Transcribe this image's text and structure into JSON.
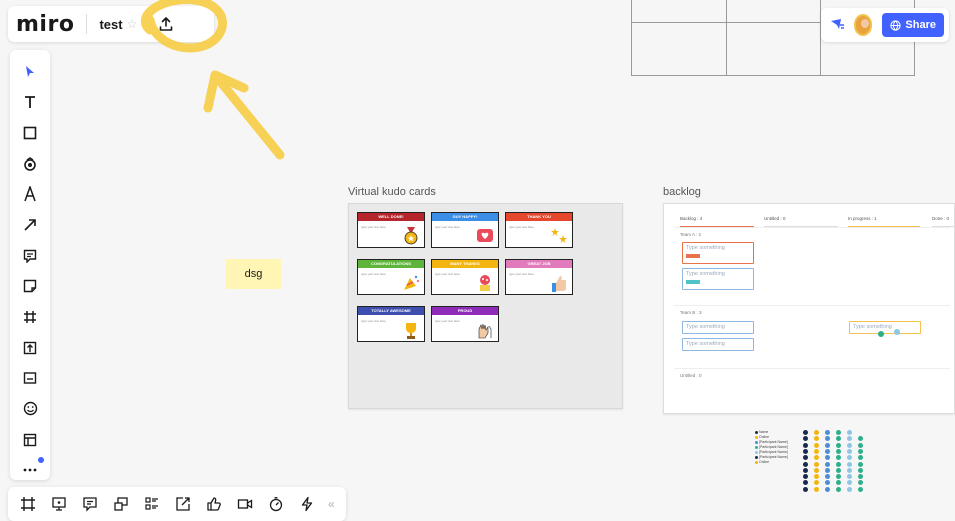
{
  "app": {
    "logo": "miro",
    "board_name": "test"
  },
  "header": {
    "share_label": "Share"
  },
  "toolbar": {
    "tools": [
      "select",
      "text",
      "shape",
      "pen",
      "line",
      "arrow",
      "comment",
      "sticky-note",
      "frame",
      "upload",
      "card",
      "emoji",
      "template",
      "more"
    ]
  },
  "bottombar": {
    "collapse_glyph": "«"
  },
  "sticky": {
    "text": "dsg"
  },
  "kudo_frame": {
    "title": "Virtual kudo cards",
    "cards": [
      {
        "heading": "WELL DONE!",
        "color": "#b5252c",
        "placeholder": "type your text here"
      },
      {
        "heading": "GUY HAPPY!",
        "color": "#3a8ee6",
        "placeholder": "type your text here"
      },
      {
        "heading": "THANK YOU",
        "color": "#e4472b",
        "placeholder": "type your text here"
      },
      {
        "heading": "CONGRATULATIONS",
        "color": "#5fb43c",
        "placeholder": "type your text here"
      },
      {
        "heading": "MANY THANKS",
        "color": "#f2b511",
        "placeholder": "type your text here"
      },
      {
        "heading": "GREAT JOB",
        "color": "#e27bbb",
        "placeholder": "type your text here"
      },
      {
        "heading": "TOTALLY AWESOME",
        "color": "#3d4eaf",
        "placeholder": "type your text here"
      },
      {
        "heading": "PROUD",
        "color": "#8e2bb8",
        "placeholder": "type your text here"
      }
    ]
  },
  "backlog_frame": {
    "title": "backlog",
    "columns": [
      {
        "label": "Backlog",
        "count": "4",
        "color": "#e8734b"
      },
      {
        "label": "Untitled",
        "count": "0",
        "color": "#dddddd"
      },
      {
        "label": "In progress",
        "count": "1",
        "color": "#f2c14e"
      },
      {
        "label": "Done",
        "count": "0",
        "color": "#dddddd"
      }
    ],
    "swimlanes": [
      {
        "label": "Team A",
        "count": "2"
      },
      {
        "label": "Team B",
        "count": "3"
      },
      {
        "label": "Untitled",
        "count": "0"
      }
    ],
    "card_placeholder": "Type something"
  },
  "legend": {
    "lines": [
      "Name",
      "Online",
      "[Participant Name]",
      "[Participant Name]",
      "[Participant Name]",
      "[Participant Name]",
      "Online"
    ],
    "colors": [
      "#1b2a4a",
      "#f2b511",
      "#4a8fd6",
      "#2fae8a",
      "#8ec6e6"
    ]
  }
}
